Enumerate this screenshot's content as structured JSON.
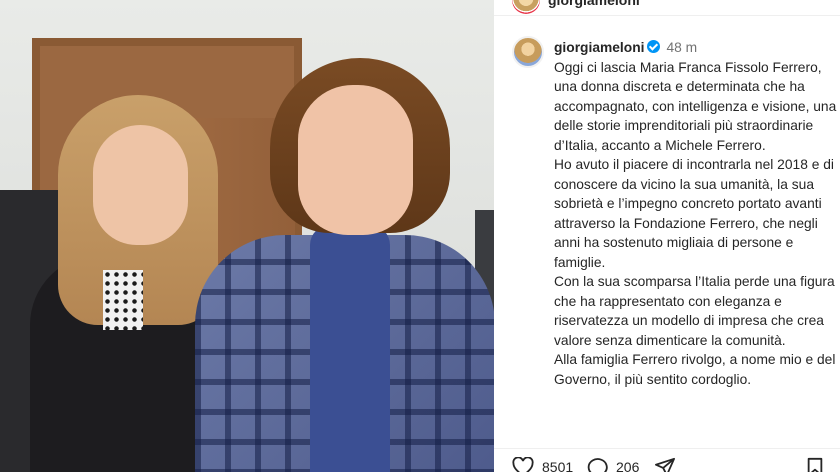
{
  "header": {
    "username": "giorgiameloni"
  },
  "post": {
    "username": "giorgiameloni",
    "verified": true,
    "time": "48 m",
    "caption_lines": [
      "Oggi ci lascia Maria Franca Fissolo Ferrero, una donna discreta e determinata che ha accompagnato, con intelligenza e visione, una delle storie imprenditoriali più straordinarie d’Italia, accanto a Michele Ferrero.",
      "Ho avuto il piacere di incontrarla nel 2018 e di conoscere da vicino la sua umanità, la sua sobrietà e l’impegno concreto portato avanti attraverso la Fondazione Ferrero, che negli anni ha sostenuto migliaia di persone e famiglie.",
      "Con la sua scomparsa l’Italia perde una figura che ha rappresentato con eleganza e riservatezza un modello di impresa che crea valore senza dimenticare la comunità.",
      "Alla famiglia Ferrero rivolgo, a nome mio e del Governo, il più sentito cordoglio."
    ]
  },
  "actions": {
    "likes": "8501",
    "comments": "206",
    "icons": {
      "like": "heart-icon",
      "comment": "comment-icon",
      "share": "share-icon",
      "save": "bookmark-icon"
    }
  },
  "colors": {
    "verified": "#0095f6",
    "text": "#262626",
    "muted": "#737373"
  }
}
